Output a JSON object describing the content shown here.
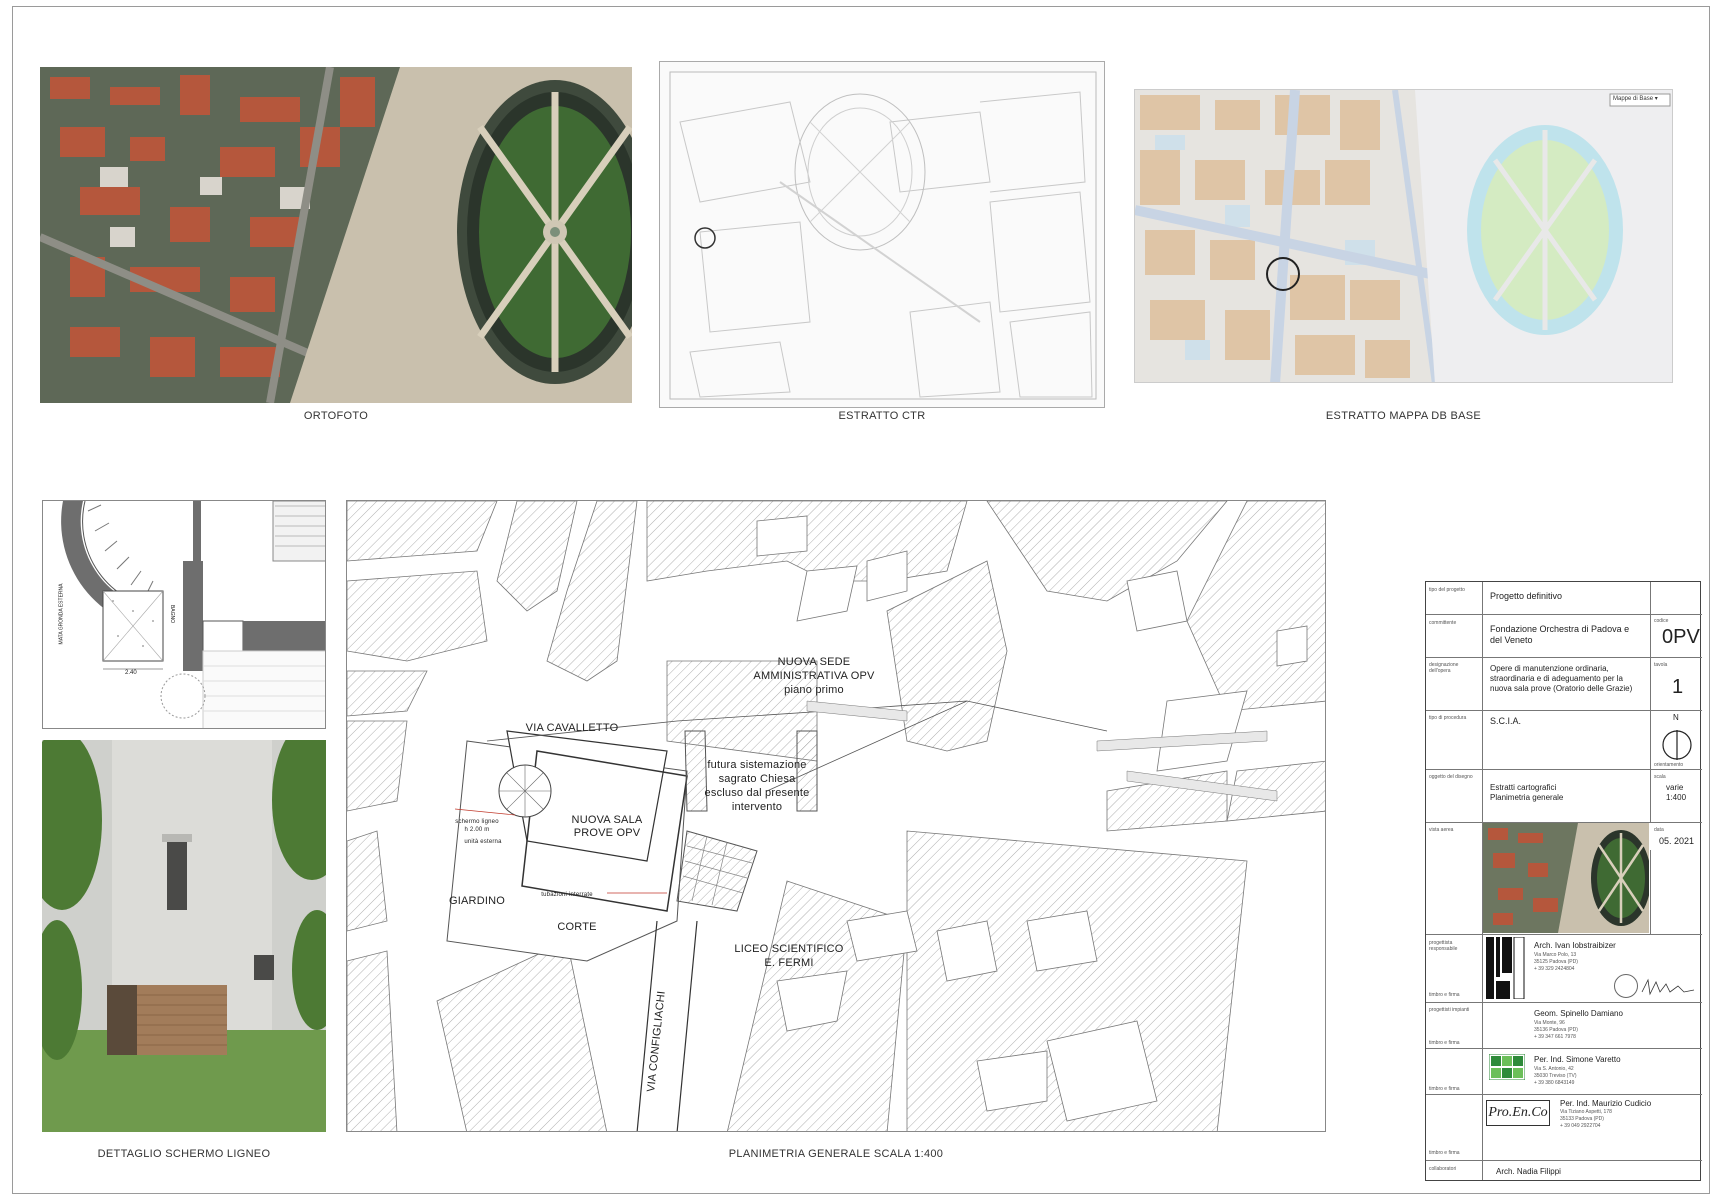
{
  "captions": {
    "ortofoto": "ORTOFOTO",
    "estratto_ctr": "ESTRATTO CTR",
    "estratto_mappa": "ESTRATTO MAPPA DB BASE",
    "dettaglio": "DETTAGLIO SCHERMO LIGNEO",
    "planimetria": "PLANIMETRIA GENERALE SCALA 1:400"
  },
  "map_button": "Mappe di Base ▾",
  "detail_labels": {
    "dimension": "2.40",
    "vertical": "MATA GRONDA ESTERNA",
    "bagno": "BAGNO"
  },
  "plan_labels": {
    "nuova_sede": "NUOVA SEDE",
    "amministrativa": "AMMINISTRATIVA OPV",
    "piano_primo": "piano primo",
    "via_cavalletto": "VIA CAVALLETTO",
    "futura_1": "futura sistemazione",
    "futura_2": "sagrato Chiesa",
    "futura_3": "escluso dal presente",
    "futura_4": "intervento",
    "nuova_sala_1": "NUOVA SALA",
    "nuova_sala_2": "PROVE OPV",
    "schermo": "schermo ligneo",
    "schermo_h": "h 2.00 m",
    "unita": "unità esterna",
    "giardino": "GIARDINO",
    "corte": "CORTE",
    "tubazioni": "tubazioni interrate",
    "liceo_1": "LICEO SCIENTIFICO",
    "liceo_2": "E. FERMI",
    "via_configliachi": "VIA CONFIGLIACHI"
  },
  "title_block": {
    "tipo_label": "tipo del progetto",
    "tipo_value": "Progetto definitivo",
    "committente_label": "committente",
    "committente_value": "Fondazione Orchestra di Padova e del Veneto",
    "codice_label": "codice",
    "codice_value": "0PV",
    "designazione_label": "designazione dell'opera",
    "designazione_value": "Opere di manutenzione ordinaria, straordinaria e di adeguamento per la nuova sala prove (Oratorio delle Grazie)",
    "numero_label": "tavola",
    "numero_value": "1",
    "tipo_procedura_label": "tipo di procedura",
    "tipo_procedura_value": "S.C.I.A.",
    "orientamento_label": "orientamento",
    "north": "N",
    "oggetto_label": "oggetto del disegno",
    "oggetto_value_1": "Estratti cartografici",
    "oggetto_value_2": "Planimetria generale",
    "scala_label": "scala",
    "scala_value_1": "varie",
    "scala_value_2": "1:400",
    "vista_label": "vista aerea",
    "data_label": "data",
    "data_value": "05. 2021",
    "progettista_label": "progettista responsabile",
    "progettista_name": "Arch. Ivan Iobstraibizer",
    "progettista_addr_1": "Via Marco Polo, 13",
    "progettista_addr_2": "35125 Padova (PD)",
    "progettista_addr_3": "+ 39 329 2424804",
    "timbro_label_1": "timbro e firma",
    "impianti_label": "progettisti impianti",
    "spinello_name": "Geom. Spinello Damiano",
    "spinello_addr_1": "Via Monte, 96",
    "spinello_addr_2": "35136 Padova (PD)",
    "spinello_addr_3": "+ 39 347 661 7978",
    "timbro_label_2": "timbro e firma",
    "varetto_name": "Per. Ind. Simone Varetto",
    "varetto_addr_1": "Via S. Antonio, 42",
    "varetto_addr_2": "35030 Treviso (TV)",
    "varetto_addr_3": "+ 39 380 6843149",
    "timbro_label_3": "timbro e firma",
    "proenco_logo": "Pro.En.Co",
    "cudicio_name": "Per. Ind. Maurizio Cudicio",
    "cudicio_addr_1": "Via Tiziano Aspetti, 178",
    "cudicio_addr_2": "35133 Padova (PD)",
    "cudicio_addr_3": "+ 39 049 2922704",
    "timbro_label_4": "timbro e firma",
    "collaboratori_label": "collaboratori",
    "collaboratori_value": "Arch. Nadia Filippi"
  }
}
